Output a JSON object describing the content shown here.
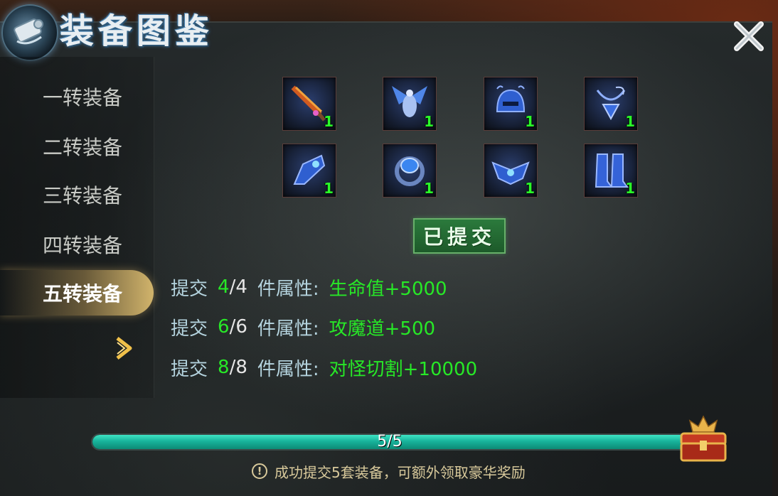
{
  "window": {
    "title": "装备图鉴"
  },
  "sidebar": {
    "tabs": [
      {
        "label": "一转装备",
        "active": false
      },
      {
        "label": "二转装备",
        "active": false
      },
      {
        "label": "三转装备",
        "active": false
      },
      {
        "label": "四转装备",
        "active": false
      },
      {
        "label": "五转装备",
        "active": true
      }
    ]
  },
  "equipment": {
    "slots": [
      {
        "icon": "sword-icon",
        "count": "1"
      },
      {
        "icon": "winged-armor-icon",
        "count": "1"
      },
      {
        "icon": "helmet-icon",
        "count": "1"
      },
      {
        "icon": "necklace-icon",
        "count": "1"
      },
      {
        "icon": "bracer-icon",
        "count": "1"
      },
      {
        "icon": "ring-icon",
        "count": "1"
      },
      {
        "icon": "belt-icon",
        "count": "1"
      },
      {
        "icon": "boots-icon",
        "count": "1"
      }
    ],
    "submitted_label": "已提交"
  },
  "bonuses": [
    {
      "prefix": "提交",
      "done": "4",
      "sep": "/",
      "total": "4",
      "label": "件属性:",
      "effect": "生命值+5000"
    },
    {
      "prefix": "提交",
      "done": "6",
      "sep": "/",
      "total": "6",
      "label": "件属性:",
      "effect": "攻魔道+500"
    },
    {
      "prefix": "提交",
      "done": "8",
      "sep": "/",
      "total": "8",
      "label": "件属性:",
      "effect": "对怪切割+10000"
    }
  ],
  "progress": {
    "text": "5/5",
    "fraction": 1.0
  },
  "notice": {
    "icon": "!",
    "text": "成功提交5套装备，可额外领取豪华奖励"
  },
  "colors": {
    "accent_green": "#27e827",
    "progress": "#18b39b",
    "tab_active": "#f0cd78"
  }
}
